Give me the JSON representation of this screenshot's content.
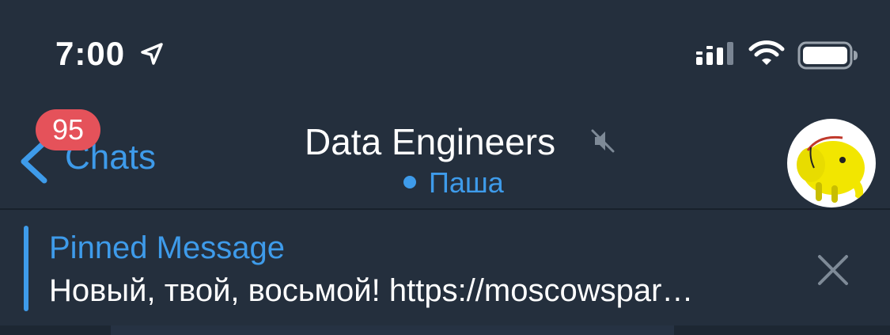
{
  "status_bar": {
    "time": "7:00",
    "icons": [
      "location-arrow-icon",
      "signal-icon",
      "wifi-icon",
      "battery-icon"
    ]
  },
  "nav": {
    "back_label": "Chats",
    "unread_badge": "95",
    "title": "Data Engineers",
    "subtitle": "Паша",
    "muted": true,
    "avatar": "hadoop-elephant-avatar"
  },
  "pinned": {
    "title": "Pinned Message",
    "text": "Новый, твой, восьмой! https://moscowspar…"
  },
  "colors": {
    "background": "#242f3d",
    "accent": "#3e9bea",
    "badge": "#e5525a"
  }
}
